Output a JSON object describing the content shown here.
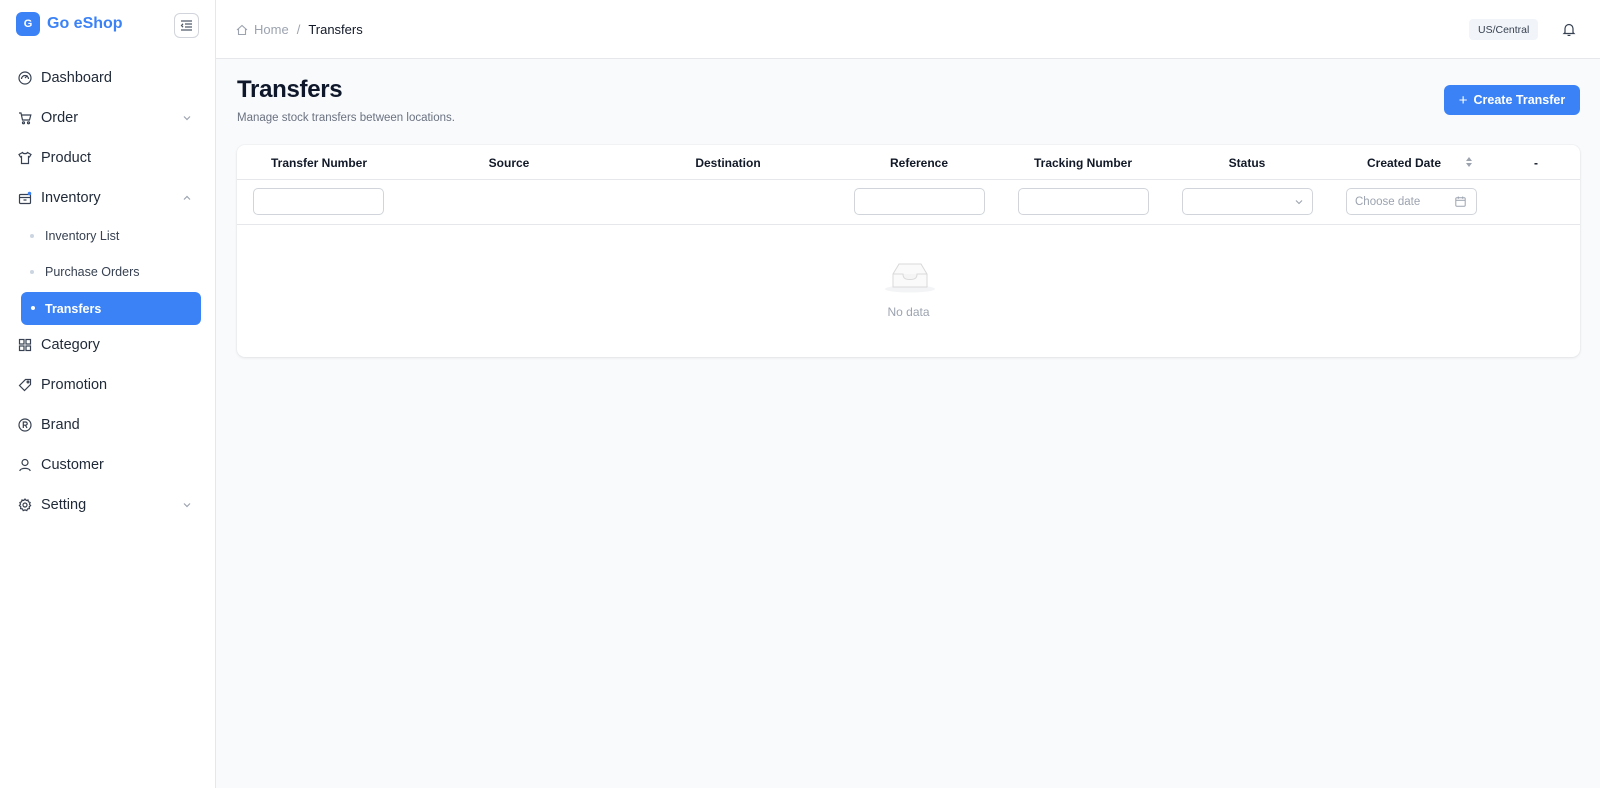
{
  "brand": {
    "logo_letter": "G",
    "name": "Go eShop"
  },
  "sidebar": {
    "items": [
      {
        "label": "Dashboard",
        "icon": "dashboard-gauge-icon"
      },
      {
        "label": "Order",
        "icon": "cart-icon",
        "expandable": true,
        "expanded": false
      },
      {
        "label": "Product",
        "icon": "shirt-icon"
      },
      {
        "label": "Inventory",
        "icon": "inventory-box-icon",
        "expandable": true,
        "expanded": true,
        "children": [
          {
            "label": "Inventory List"
          },
          {
            "label": "Purchase Orders"
          },
          {
            "label": "Transfers",
            "active": true
          }
        ]
      },
      {
        "label": "Category",
        "icon": "grid-icon"
      },
      {
        "label": "Promotion",
        "icon": "tag-icon"
      },
      {
        "label": "Brand",
        "icon": "registered-icon"
      },
      {
        "label": "Customer",
        "icon": "user-icon"
      },
      {
        "label": "Setting",
        "icon": "gear-icon",
        "expandable": true,
        "expanded": false
      }
    ]
  },
  "header": {
    "breadcrumb": {
      "home": "Home",
      "separator": "/",
      "current": "Transfers"
    },
    "timezone": "US/Central"
  },
  "page": {
    "title": "Transfers",
    "subtitle": "Manage stock transfers between locations.",
    "create_button": {
      "icon": "plus-icon",
      "label": "Create Transfer"
    }
  },
  "table": {
    "columns": [
      "Transfer Number",
      "Source",
      "Destination",
      "Reference",
      "Tracking Number",
      "Status",
      "Created Date",
      "-"
    ],
    "filters": {
      "transfer_number": "",
      "reference": "",
      "tracking_number": "",
      "status": "",
      "created_date_placeholder": "Choose date"
    },
    "empty_text": "No data"
  },
  "colors": {
    "accent": "#3b82f6",
    "background": "#f8fafc"
  }
}
